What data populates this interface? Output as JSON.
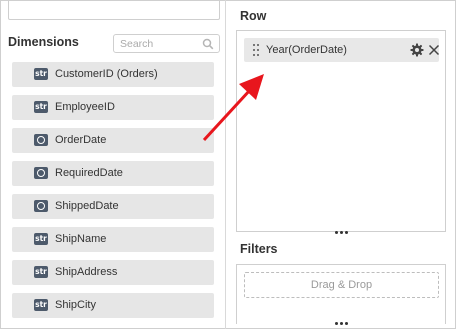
{
  "dimensions_panel": {
    "title": "Dimensions",
    "search_placeholder": "Search",
    "items": [
      {
        "label": "CustomerID (Orders)",
        "type_badge": "str",
        "icon": "string-icon"
      },
      {
        "label": "EmployeeID",
        "type_badge": "str",
        "icon": "string-icon"
      },
      {
        "label": "OrderDate",
        "type_badge": "",
        "icon": "date-icon"
      },
      {
        "label": "RequiredDate",
        "type_badge": "",
        "icon": "date-icon"
      },
      {
        "label": "ShippedDate",
        "type_badge": "",
        "icon": "date-icon"
      },
      {
        "label": "ShipName",
        "type_badge": "str",
        "icon": "string-icon"
      },
      {
        "label": "ShipAddress",
        "type_badge": "str",
        "icon": "string-icon"
      },
      {
        "label": "ShipCity",
        "type_badge": "str",
        "icon": "string-icon"
      }
    ]
  },
  "row_section": {
    "title": "Row",
    "pill": {
      "label": "Year(OrderDate)"
    }
  },
  "filters_section": {
    "title": "Filters",
    "drop_label": "Drag & Drop"
  },
  "colors": {
    "arrow": "#e8161d",
    "item_background": "#e6e6e6",
    "badge": "#4d5a6b"
  }
}
